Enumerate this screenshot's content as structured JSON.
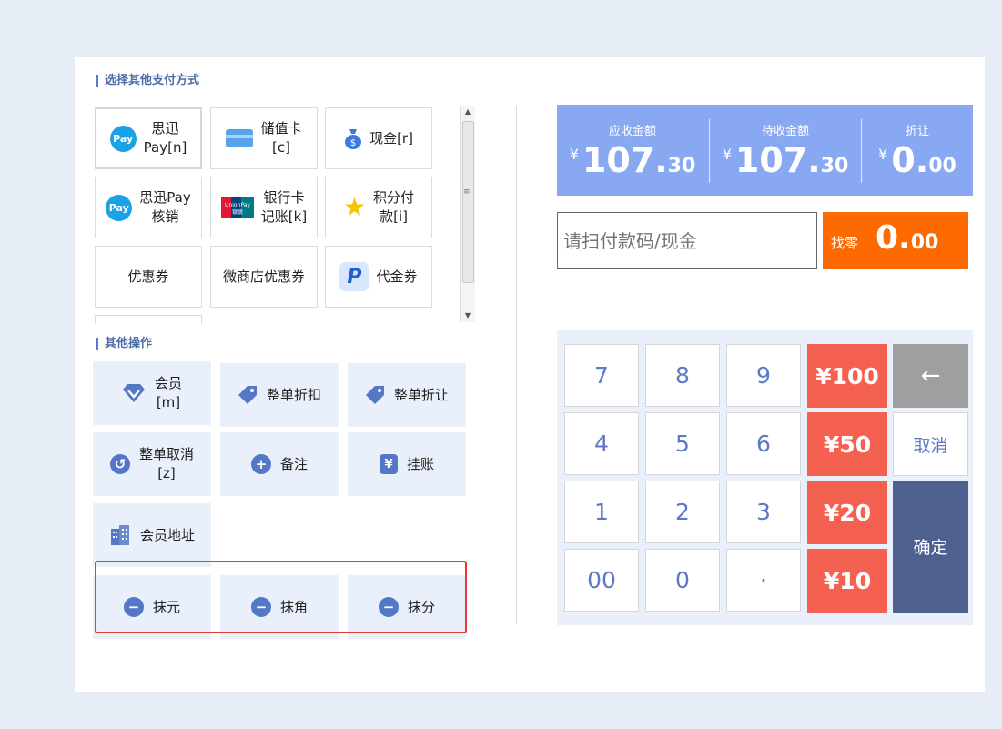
{
  "sections": {
    "pay_title": "选择其他支付方式",
    "ops_title": "其他操作"
  },
  "pay_methods": [
    {
      "label": "思迅\nPay[n]",
      "icon": "pay-icon"
    },
    {
      "label": "储值卡\n[c]",
      "icon": "card-icon"
    },
    {
      "label": "现金[r]",
      "icon": "money-bag-icon"
    },
    {
      "label": "思迅Pay\n核销",
      "icon": "pay-icon"
    },
    {
      "label": "银行卡\n记账[k]",
      "icon": "unionpay-icon"
    },
    {
      "label": "积分付\n款[i]",
      "icon": "star-icon"
    },
    {
      "label": "优惠券",
      "icon": ""
    },
    {
      "label": "微商店优惠券",
      "icon": ""
    },
    {
      "label": "代金券",
      "icon": "paypal-icon"
    }
  ],
  "operations": [
    {
      "label": "会员\n[m]",
      "icon": "diamond-icon"
    },
    {
      "label": "整单折扣",
      "icon": "tag-icon"
    },
    {
      "label": "整单折让",
      "icon": "tag-icon"
    },
    {
      "label": "整单取消\n[z]",
      "icon": "undo-icon"
    },
    {
      "label": "备注",
      "icon": "plus-icon"
    },
    {
      "label": "挂账",
      "icon": "yen-icon"
    },
    {
      "label": "会员地址",
      "icon": "building-icon"
    },
    {
      "label": "抹元",
      "icon": "minus-icon"
    },
    {
      "label": "抹角",
      "icon": "minus-icon"
    },
    {
      "label": "抹分",
      "icon": "minus-icon"
    }
  ],
  "amounts": {
    "currency": "¥",
    "receivable": {
      "label": "应收金额",
      "int": "107.",
      "dec": "30"
    },
    "pending": {
      "label": "待收金额",
      "int": "107.",
      "dec": "30"
    },
    "discount": {
      "label": "折让",
      "int": "0.",
      "dec": "00"
    }
  },
  "scan_input": {
    "placeholder": "请扫付款码/现金",
    "value": ""
  },
  "change": {
    "label": "找零",
    "int": "0.",
    "dec": "00"
  },
  "keypad": {
    "k7": "7",
    "k8": "8",
    "k9": "9",
    "k4": "4",
    "k5": "5",
    "k6": "6",
    "k1": "1",
    "k2": "2",
    "k3": "3",
    "k00": "00",
    "k0": "0",
    "kdot": "·",
    "q100": "¥100",
    "q50": "¥50",
    "q20": "¥20",
    "q10": "¥10",
    "backspace": "←",
    "cancel": "取消",
    "confirm": "确定"
  },
  "colors": {
    "amount_bar": "#89a8f2",
    "change_box": "#ff6a00",
    "quick_cash": "#f56150",
    "confirm": "#4e6090",
    "highlight": "#e83a32"
  }
}
